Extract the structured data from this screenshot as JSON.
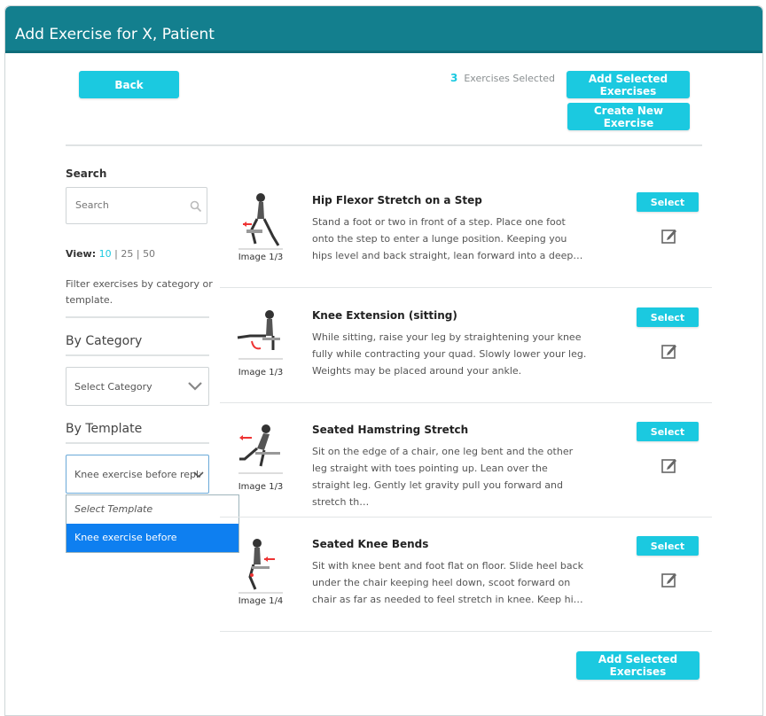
{
  "window": {
    "title": "Add Exercise for X, Patient"
  },
  "toolbar": {
    "back_label": "Back",
    "selected_count": "3",
    "selected_text": "Exercises Selected",
    "add_selected_label": "Add Selected Exercises",
    "create_new_label": "Create New Exercise"
  },
  "sidebar": {
    "search_heading": "Search",
    "search_placeholder": "Search",
    "view_label": "View:",
    "view_options": [
      "10",
      "25",
      "50"
    ],
    "view_separator": "|",
    "filter_note": "Filter exercises by category or template.",
    "category_heading": "By Category",
    "category_value": "Select Category",
    "template_heading": "By Template",
    "template_value": "Knee exercise before repla",
    "template_options": [
      "Select Template",
      "Knee exercise before replacement"
    ]
  },
  "exercises": [
    {
      "title": "Hip Flexor Stretch on a Step",
      "image_caption": "Image 1/3",
      "description": "Stand a foot or two in front of a step. Place one foot onto the step to enter a lunge position. Keeping you hips level and back straight, lean forward into a deep…",
      "select_label": "Select"
    },
    {
      "title": "Knee Extension (sitting)",
      "image_caption": "Image 1/3",
      "description": "While sitting, raise your leg by straightening your knee fully while contracting your quad. Slowly lower your leg. Weights may be placed around your ankle.",
      "select_label": "Select"
    },
    {
      "title": "Seated Hamstring Stretch",
      "image_caption": "Image 1/3",
      "description": "Sit on the edge of a chair, one leg bent and the other leg straight with toes pointing up. Lean over the straight leg. Gently let gravity pull you forward and stretch th…",
      "select_label": "Select"
    },
    {
      "title": "Seated Knee Bends",
      "image_caption": "Image 1/4",
      "description": "Sit with knee bent and foot flat on floor. Slide heel back under the chair keeping heel down, scoot forward on chair as far as needed to feel stretch in knee. Keep hi…",
      "select_label": "Select"
    }
  ],
  "footer": {
    "add_selected_label": "Add Selected Exercises"
  },
  "colors": {
    "header": "#137f8e",
    "accent": "#1bc9e0",
    "highlight": "#0e7ff0"
  }
}
